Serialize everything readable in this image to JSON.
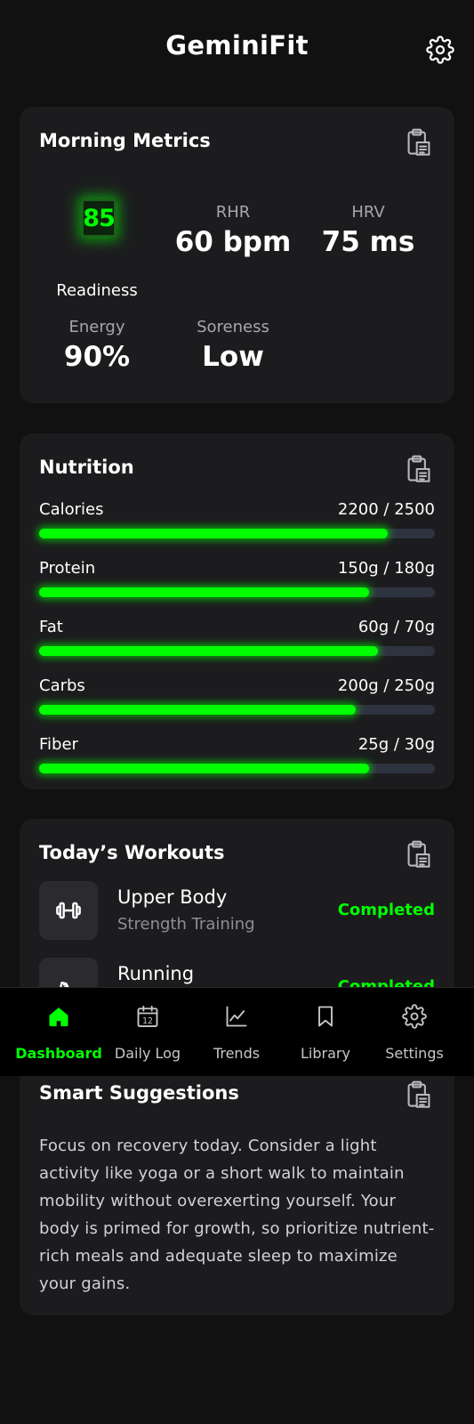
{
  "header": {
    "title": "GeminiFit",
    "settings_icon": "gear-icon"
  },
  "morning_metrics": {
    "title": "Morning Metrics",
    "icon": "clipboard-icon",
    "readiness": {
      "value": "85",
      "label": "Readiness"
    },
    "rhr": {
      "label": "RHR",
      "value": "60 bpm"
    },
    "hrv": {
      "label": "HRV",
      "value": "75 ms"
    },
    "energy": {
      "label": "Energy",
      "value": "90%"
    },
    "soreness": {
      "label": "Soreness",
      "value": "Low"
    }
  },
  "nutrition": {
    "title": "Nutrition",
    "icon": "clipboard-icon",
    "items": [
      {
        "name": "Calories",
        "value": "2200 / 2500",
        "fraction": 0.88
      },
      {
        "name": "Protein",
        "value": "150g / 180g",
        "fraction": 0.833
      },
      {
        "name": "Fat",
        "value": "60g / 70g",
        "fraction": 0.857
      },
      {
        "name": "Carbs",
        "value": "200g / 250g",
        "fraction": 0.8
      },
      {
        "name": "Fiber",
        "value": "25g / 30g",
        "fraction": 0.833
      }
    ],
    "colors": {
      "fill": "#00ff00",
      "track": "#2e3340"
    }
  },
  "workouts": {
    "title": "Today’s Workouts",
    "icon": "clipboard-icon",
    "items": [
      {
        "name": "Upper Body",
        "type": "Strength Training",
        "status": "Completed",
        "icon": "dumbbell-icon"
      },
      {
        "name": "Running",
        "type": "",
        "status": "Completed",
        "icon": "running-shoe-icon"
      }
    ]
  },
  "suggestions": {
    "title": "Smart Suggestions",
    "icon": "clipboard-icon",
    "text": "Focus on recovery today. Consider a light activity like yoga or a short walk to maintain mobility without overexerting yourself. Your body is primed for growth, so prioritize nutrient-rich meals and adequate sleep to maximize your gains."
  },
  "nav": {
    "items": [
      {
        "label": "Dashboard",
        "icon": "home-icon",
        "active": true
      },
      {
        "label": "Daily Log",
        "icon": "calendar-icon",
        "calendar_day": "12",
        "active": false
      },
      {
        "label": "Trends",
        "icon": "line-chart-icon",
        "active": false
      },
      {
        "label": "Library",
        "icon": "bookmark-icon",
        "active": false
      },
      {
        "label": "Settings",
        "icon": "gear-icon",
        "active": false
      }
    ],
    "active_color": "#00ff00"
  },
  "colors": {
    "accent": "#00ff00",
    "background": "#111111",
    "card": "#1c1c1e"
  }
}
